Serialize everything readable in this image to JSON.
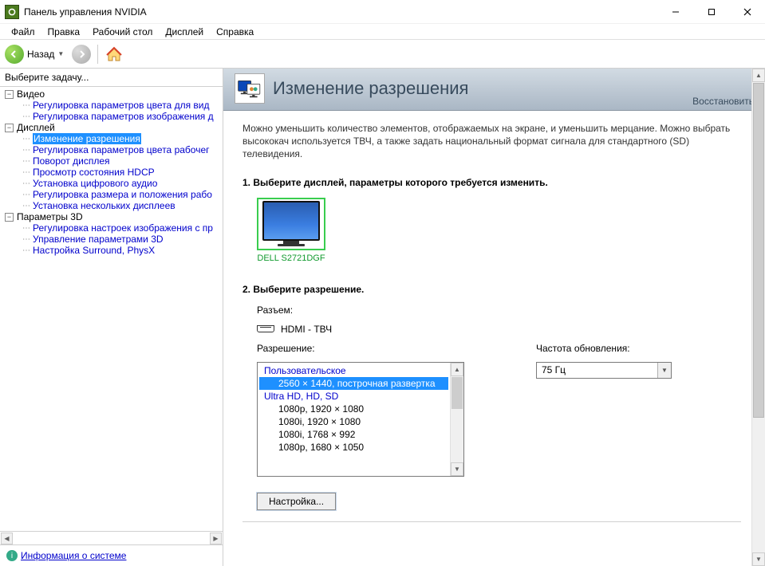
{
  "window": {
    "title": "Панель управления NVIDIA"
  },
  "menu": [
    "Файл",
    "Правка",
    "Рабочий стол",
    "Дисплей",
    "Справка"
  ],
  "toolbar": {
    "back": "Назад"
  },
  "sidebar": {
    "header": "Выберите задачу...",
    "groups": [
      {
        "label": "Видео",
        "items": [
          "Регулировка параметров цвета для вид",
          "Регулировка параметров изображения д"
        ]
      },
      {
        "label": "Дисплей",
        "items": [
          "Изменение разрешения",
          "Регулировка параметров цвета рабочег",
          "Поворот дисплея",
          "Просмотр состояния HDCP",
          "Установка цифрового аудио",
          "Регулировка размера и положения рабо",
          "Установка нескольких дисплеев"
        ],
        "selected": 0
      },
      {
        "label": "Параметры 3D",
        "items": [
          "Регулировка настроек изображения с пр",
          "Управление параметрами 3D",
          "Настройка Surround, PhysX"
        ]
      }
    ]
  },
  "sysinfo": "Информация о системе",
  "page": {
    "title": "Изменение разрешения",
    "restore": "Восстановить",
    "desc": "Можно уменьшить количество элементов, отображаемых на экране, и уменьшить мерцание. Можно выбрать высококач используется ТВЧ, а также задать национальный формат сигнала для стандартного (SD) телевидения.",
    "step1": "1. Выберите дисплей, параметры которого требуется изменить.",
    "monitor_name": "DELL S2721DGF",
    "step2": "2. Выберите разрешение.",
    "connector_label": "Разъем:",
    "connector_value": "HDMI - ТВЧ",
    "resolution_label": "Разрешение:",
    "refresh_label": "Частота обновления:",
    "refresh_value": "75 Гц",
    "res_group_custom": "Пользовательское",
    "res_selected": "2560 × 1440, построчная развертка",
    "res_group_hd": "Ultra HD, HD, SD",
    "res_items": [
      "1080p, 1920 × 1080",
      "1080i, 1920 × 1080",
      "1080i, 1768 × 992",
      "1080p, 1680 × 1050"
    ],
    "config_button": "Настройка..."
  }
}
